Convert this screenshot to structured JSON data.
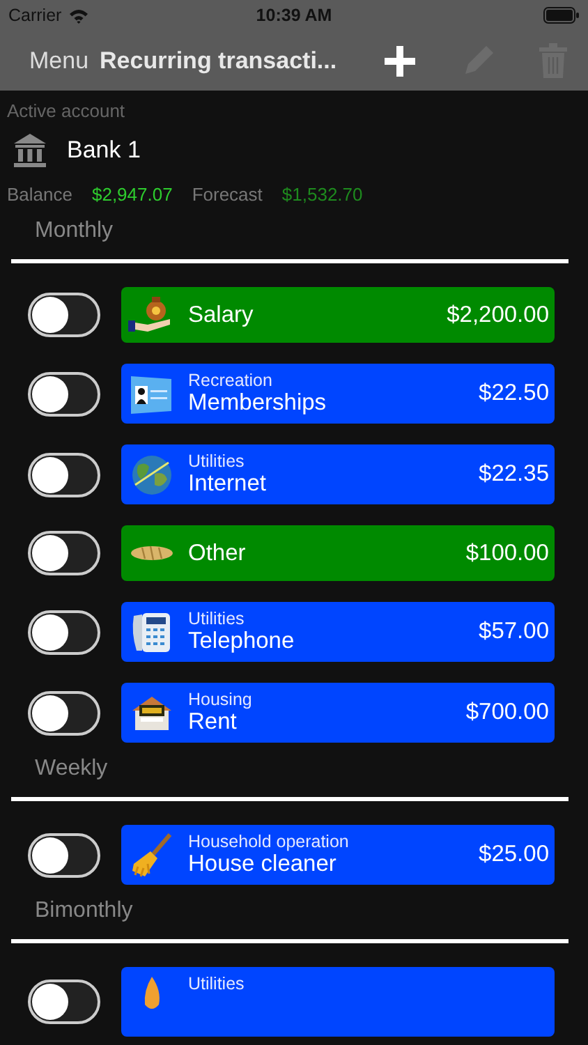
{
  "status_bar": {
    "carrier": "Carrier",
    "time": "10:39 AM"
  },
  "nav_bar": {
    "menu": "Menu",
    "title": "Recurring transacti...",
    "actions": [
      {
        "kind": "add",
        "disabled": false
      },
      {
        "kind": "edit",
        "disabled": true
      },
      {
        "kind": "delete",
        "disabled": true
      }
    ]
  },
  "account": {
    "label": "Active account",
    "name": "Bank 1",
    "balance_label": "Balance",
    "balance": "$2,947.07",
    "forecast_label": "Forecast",
    "forecast": "$1,532.70"
  },
  "sections": [
    {
      "title": "Monthly",
      "items": [
        {
          "kind": "salary",
          "name": "Salary",
          "amount": "$2,200.00",
          "color": "#008a00",
          "on": false
        },
        {
          "kind": "membership",
          "category": "Recreation",
          "name": "Memberships",
          "amount": "$22.50",
          "color": "#0045ff",
          "on": false
        },
        {
          "kind": "globe",
          "category": "Utilities",
          "name": "Internet",
          "amount": "$22.35",
          "color": "#0045ff",
          "on": false
        },
        {
          "kind": "bread",
          "name": "Other",
          "amount": "$100.00",
          "color": "#008a00",
          "on": false
        },
        {
          "kind": "phone",
          "category": "Utilities",
          "name": "Telephone",
          "amount": "$57.00",
          "color": "#0045ff",
          "on": false
        },
        {
          "kind": "house",
          "category": "Housing",
          "name": "Rent",
          "amount": "$700.00",
          "color": "#0045ff",
          "on": false
        }
      ]
    },
    {
      "title": "Weekly",
      "items": [
        {
          "kind": "broom",
          "category": "Household operation",
          "name": "House cleaner",
          "amount": "$25.00",
          "color": "#0045ff",
          "on": false
        }
      ]
    },
    {
      "title": "Bimonthly",
      "items": [
        {
          "kind": "flame",
          "category": "Utilities",
          "color": "#0045ff",
          "on": false
        }
      ]
    }
  ]
}
